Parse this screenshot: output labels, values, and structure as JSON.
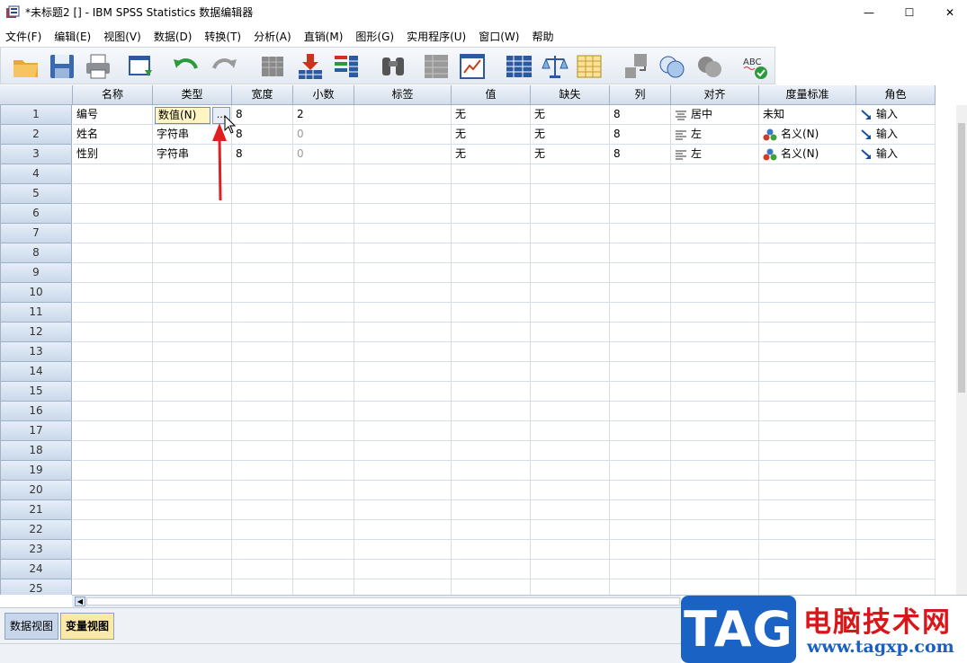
{
  "window": {
    "title": "*未标题2 [] - IBM SPSS Statistics 数据编辑器",
    "minimize_glyph": "—",
    "maximize_glyph": "☐",
    "close_glyph": "✕"
  },
  "menu": [
    "文件(F)",
    "编辑(E)",
    "视图(V)",
    "数据(D)",
    "转换(T)",
    "分析(A)",
    "直销(M)",
    "图形(G)",
    "实用程序(U)",
    "窗口(W)",
    "帮助"
  ],
  "toolbar_icons": [
    "open-folder-icon",
    "save-icon",
    "print-icon",
    "recall-dialog-icon",
    "undo-icon",
    "redo-icon",
    "goto-case-icon",
    "goto-variable-icon",
    "variables-icon",
    "find-icon",
    "insert-cases-icon",
    "insert-variable-icon",
    "split-file-icon",
    "weight-cases-icon",
    "select-cases-icon",
    "value-labels-icon",
    "use-sets-icon",
    "show-all-variables-icon",
    "spell-check-icon"
  ],
  "columns": [
    "名称",
    "类型",
    "宽度",
    "小数",
    "标签",
    "值",
    "缺失",
    "列",
    "对齐",
    "度量标准",
    "角色"
  ],
  "variables": [
    {
      "row": "1",
      "name": "编号",
      "type": "数值(N)",
      "width": "8",
      "decimals": "2",
      "label": "",
      "values": "无",
      "missing": "无",
      "columns": "8",
      "align": "居中",
      "measure": "未知",
      "role": "输入"
    },
    {
      "row": "2",
      "name": "姓名",
      "type": "字符串",
      "width": "8",
      "decimals": "0",
      "label": "",
      "values": "无",
      "missing": "无",
      "columns": "8",
      "align": "左",
      "measure": "名义(N)",
      "role": "输入"
    },
    {
      "row": "3",
      "name": "性别",
      "type": "字符串",
      "width": "8",
      "decimals": "0",
      "label": "",
      "values": "无",
      "missing": "无",
      "columns": "8",
      "align": "左",
      "measure": "名义(N)",
      "role": "输入"
    }
  ],
  "empty_rows": [
    "4",
    "5",
    "6",
    "7",
    "8",
    "9",
    "10",
    "11",
    "12",
    "13",
    "14",
    "15",
    "16",
    "17",
    "18",
    "19",
    "20",
    "21",
    "22",
    "23",
    "24",
    "25"
  ],
  "type_button_label": "...",
  "tabs": {
    "data_view": "数据视图",
    "variable_view": "变量视图"
  },
  "watermark": {
    "logo": "TAG",
    "site_name": "电脑技术网",
    "url": "www.tagxp.com"
  },
  "colors": {
    "accent": "#1a63c5",
    "header": "#d3ddea",
    "selected_cell": "#fff5c2",
    "annotation_arrow": "#e02020",
    "watermark_red": "#d9161a"
  }
}
